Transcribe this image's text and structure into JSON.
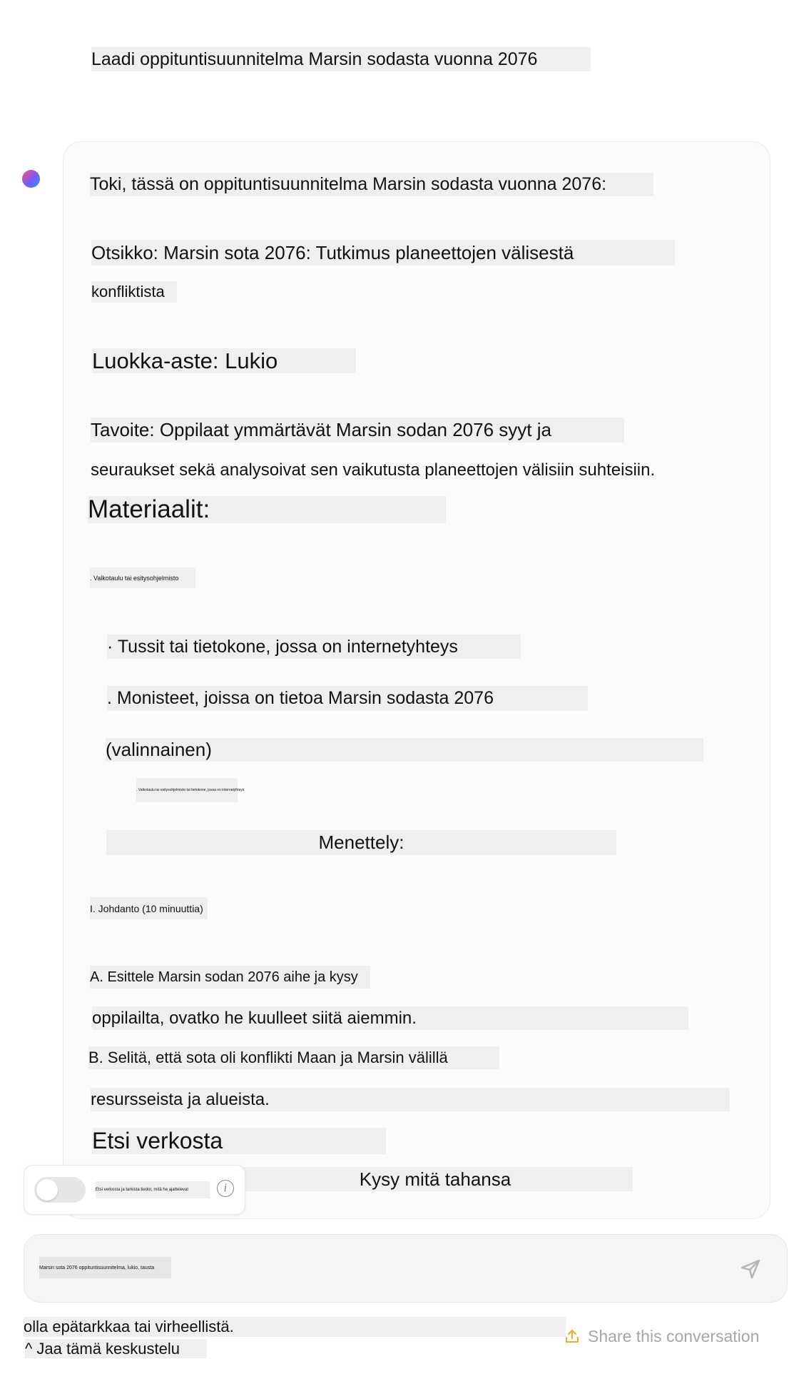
{
  "user_message": "Laadi oppituntisuunnitelma Marsin sodasta vuonna 2076",
  "assistant": {
    "intro": "Toki, tässä on oppituntisuunnitelma Marsin sodasta vuonna 2076:",
    "title_line1": "Otsikko: Marsin sota 2076: Tutkimus planeettojen välisestä",
    "title_line2": "konfliktista",
    "grade": "Luokka-aste: Lukio",
    "goal_line1": "Tavoite: Oppilaat ymmärtävät Marsin sodan 2076 syyt ja",
    "goal_line2": "seuraukset sekä analysoivat sen vaikutusta planeettojen välisiin suhteisiin.",
    "materials_heading": "Materiaalit:",
    "materials": [
      ". Valkotaulu tai esitysohjelmisto",
      "· Tussit tai tietokone, jossa on internetyhteys",
      ". Monisteet, joissa on tietoa Marsin sodasta 2076",
      "(valinnainen)",
      ". Valkotaulu tai esitysohjelmisto tai tietokone, jossa on internetyhteys"
    ],
    "procedure_heading": "Menettely:",
    "procedure_intro": "I. Johdanto (10 minuuttia)",
    "step_a_line1": "A. Esittele Marsin sodan 2076 aihe ja kysy",
    "step_a_line2": "oppilailta, ovatko he kuulleet siitä aiemmin.",
    "step_b_line1": "B. Selitä, että sota oli konflikti Maan ja Marsin välillä",
    "step_b_line2": "resursseista ja alueista.",
    "search_heading": "Etsi verkosta",
    "ask_anything": "Kysy mitä tahansa"
  },
  "web_search_toggle": {
    "label": "Etsi verkosta ja tarkista tiedot, mitä he ajattelevat",
    "enabled": false,
    "info_icon": "info-icon"
  },
  "input": {
    "text": "Marsin sota 2076 oppituntisuunnitelma, lukio, tausta"
  },
  "footer": {
    "disclaimer": "olla epätarkkaa tai virheellistä.",
    "share_fi": "^ Jaa tämä keskustelu",
    "share_en": "Share this conversation"
  },
  "colors": {
    "highlight": "#efefef",
    "card_bg": "#fbfbfb",
    "share_accent": "#f5a623",
    "muted": "#a6a6a6"
  }
}
